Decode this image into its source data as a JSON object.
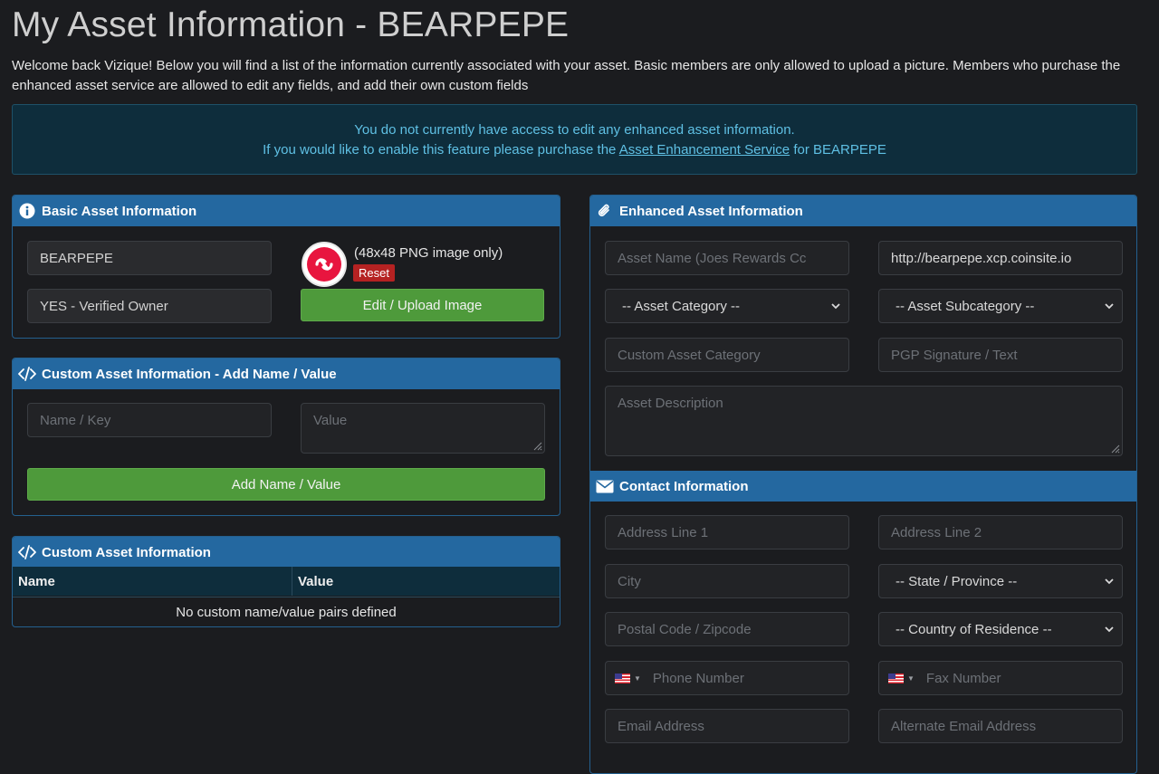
{
  "page": {
    "title": "My Asset Information - BEARPEPE",
    "intro": "Welcome back Vizique! Below you will find a list of the information currently associated with your asset. Basic members are only allowed to upload a picture. Members who purchase the enhanced asset service are allowed to edit any fields, and add their own custom fields"
  },
  "alert": {
    "line1": "You do not currently have access to edit any enhanced asset information.",
    "line2_prefix": "If you would like to enable this feature please purchase the ",
    "link": "Asset Enhancement Service",
    "line2_suffix": " for BEARPEPE"
  },
  "basic": {
    "header": "Basic Asset Information",
    "asset_name": "BEARPEPE",
    "owner_status": "YES - Verified Owner",
    "image_note": "(48x48 PNG image only)",
    "reset_label": "Reset",
    "upload_label": "Edit / Upload Image"
  },
  "custom_add": {
    "header": "Custom Asset Information - Add Name / Value",
    "name_placeholder": "Name / Key",
    "value_placeholder": "Value",
    "add_label": "Add Name / Value"
  },
  "custom_list": {
    "header": "Custom Asset Information",
    "columns": [
      "Name",
      "Value"
    ],
    "empty_text": "No custom name/value pairs defined"
  },
  "enhanced": {
    "header": "Enhanced Asset Information",
    "asset_name_placeholder": "Asset Name (Joes Rewards Cc",
    "website": "http://bearpepe.xcp.coinsite.io",
    "category_select": "-- Asset Category --",
    "subcategory_select": "-- Asset Subcategory --",
    "custom_category_placeholder": "Custom Asset Category",
    "pgp_placeholder": "PGP Signature / Text",
    "description_placeholder": "Asset Description"
  },
  "contact": {
    "header": "Contact Information",
    "address1": "Address Line 1",
    "address2": "Address Line 2",
    "city": "City",
    "state_select": "-- State / Province --",
    "postal": "Postal Code / Zipcode",
    "country_select": "-- Country of Residence --",
    "phone": "Phone Number",
    "fax": "Fax Number",
    "email": "Email Address",
    "alt_email": "Alternate Email Address"
  },
  "colors": {
    "panel_header": "#2468a0",
    "alert_bg": "#0e2d3c",
    "alert_text": "#5fc0e4",
    "green_button": "#4e9a3b",
    "red_button": "#b52222"
  }
}
